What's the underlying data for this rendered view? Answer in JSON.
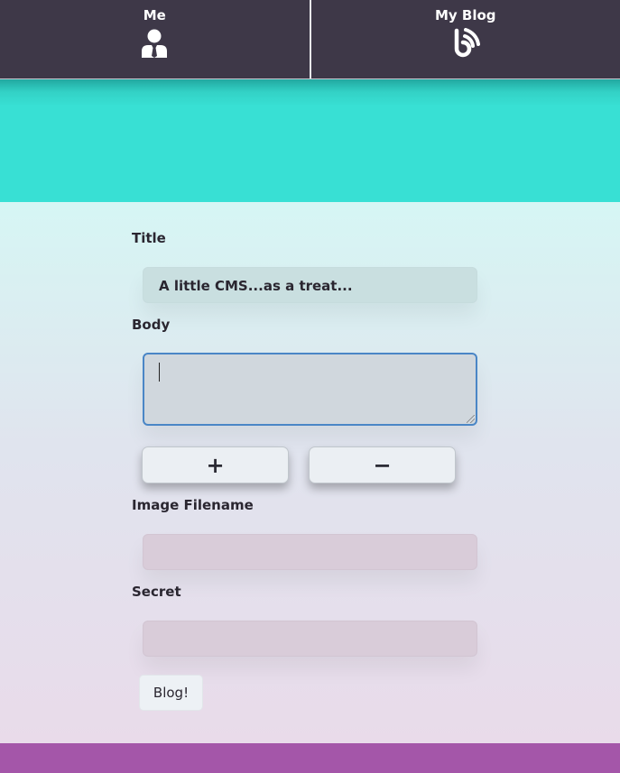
{
  "nav": {
    "items": [
      {
        "label": "Me",
        "icon": "user-icon"
      },
      {
        "label": "My Blog",
        "icon": "blog-feed-icon"
      }
    ]
  },
  "form": {
    "title_label": "Title",
    "title_value": "A little CMS...as a treat...",
    "body_label": "Body",
    "body_value": "",
    "plus_label": "+",
    "minus_label": "−",
    "image_label": "Image Filename",
    "image_value": "",
    "secret_label": "Secret",
    "secret_value": "",
    "submit_label": "Blog!"
  },
  "colors": {
    "nav_bg": "#3e3848",
    "hero": "#38e0d4",
    "footer": "#a456a9",
    "focus_border": "#4a86c6"
  }
}
